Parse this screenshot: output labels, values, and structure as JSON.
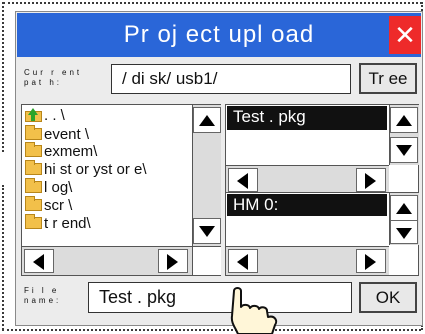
{
  "dialog": {
    "title": "Pr oj ect  upl oad",
    "close_icon": "close-icon"
  },
  "current_path": {
    "label_line1": "Cur r ent",
    "label_line2": "pat h:",
    "value": "/ di sk/ usb1/",
    "tree_button": "Tr ee"
  },
  "folder_tree": {
    "items": [
      {
        "icon": "up-folder-icon",
        "label": ". . \\"
      },
      {
        "icon": "folder-icon",
        "label": "event \\"
      },
      {
        "icon": "folder-icon",
        "label": "exmem\\"
      },
      {
        "icon": "folder-icon",
        "label": "hi st or yst or e\\"
      },
      {
        "icon": "folder-icon",
        "label": "l og\\"
      },
      {
        "icon": "folder-icon",
        "label": "scr \\"
      },
      {
        "icon": "folder-icon",
        "label": "t r end\\"
      }
    ]
  },
  "file_list": {
    "selected": "Test . pkg"
  },
  "device_list": {
    "selected": "HM 0:"
  },
  "file_name": {
    "label_line1": "Fi l e",
    "label_line2": "name:",
    "value": "Test . pkg",
    "ok_button": "OK"
  },
  "colors": {
    "title_bar": "#2a66d8",
    "close_button": "#ee2a2a",
    "folder": "#f2c04a",
    "up_arrow": "#2aa42a"
  }
}
